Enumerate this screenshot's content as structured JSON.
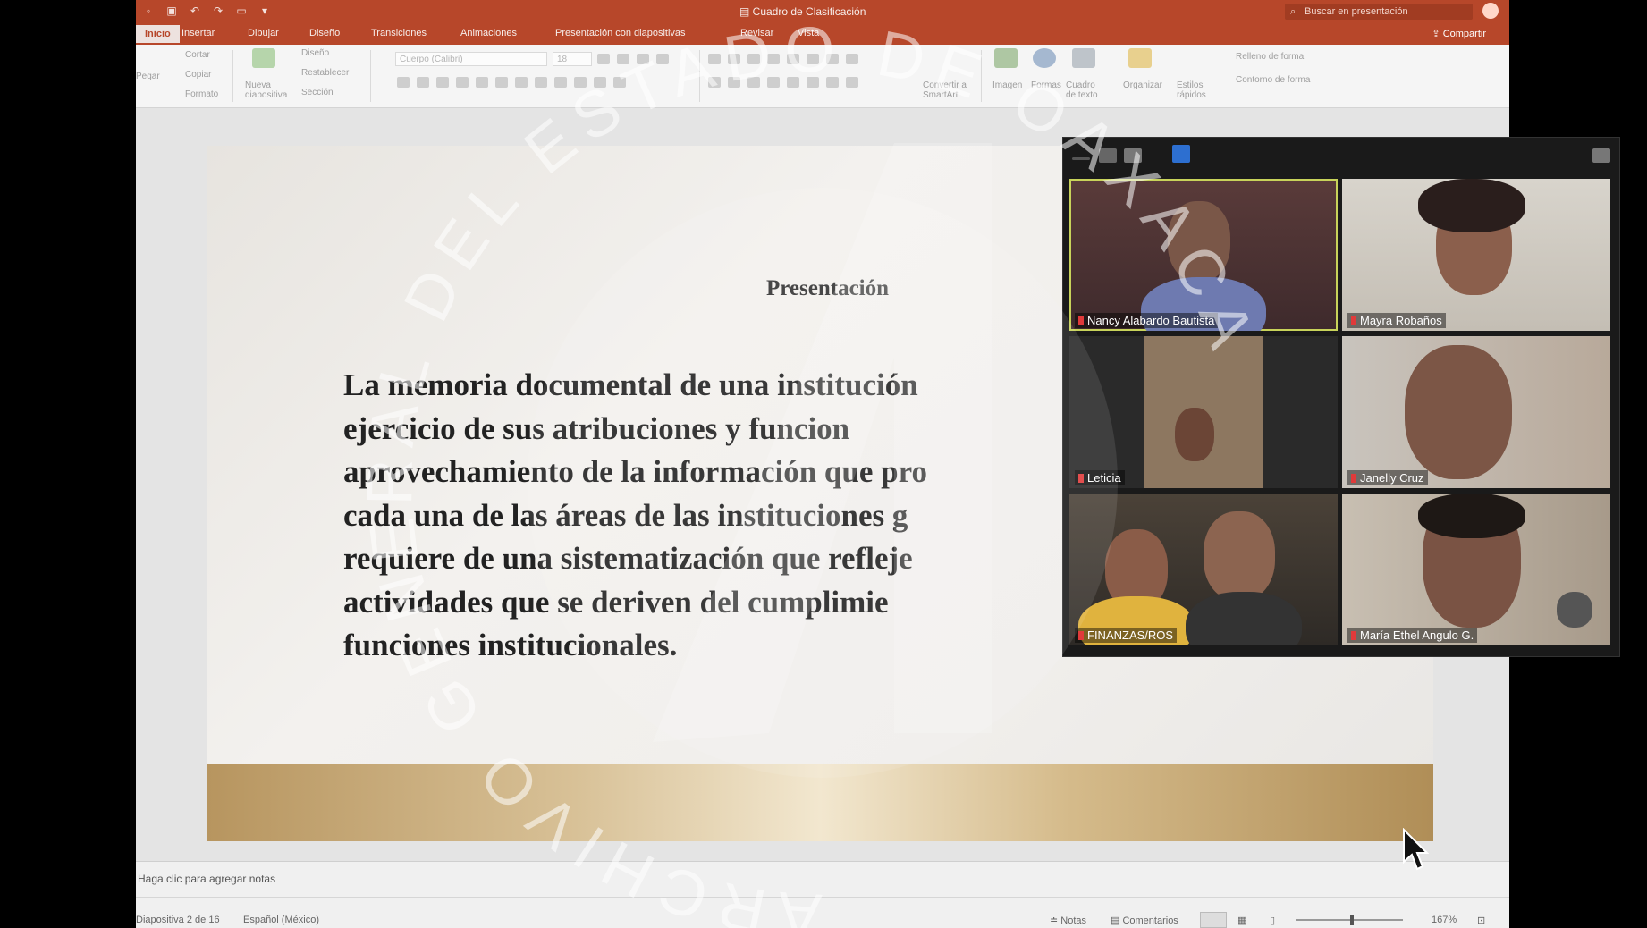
{
  "window": {
    "title": "Cuadro de Clasificación"
  },
  "quick_access": [
    "save-icon",
    "undo-icon",
    "redo-icon",
    "repeat-icon",
    "start-icon",
    "customize-icon"
  ],
  "search": {
    "placeholder": "Buscar en presentación"
  },
  "ribbon_tabs": [
    {
      "label": "Inicio"
    },
    {
      "label": "Insertar"
    },
    {
      "label": "Dibujar"
    },
    {
      "label": "Diseño"
    },
    {
      "label": "Transiciones"
    },
    {
      "label": "Animaciones"
    },
    {
      "label": "Presentación con diapositivas"
    },
    {
      "label": "Revisar"
    },
    {
      "label": "Vista"
    }
  ],
  "share_label": "Compartir",
  "ribbon": {
    "pegar": "Pegar",
    "cortar": "Cortar",
    "copiar": "Copiar",
    "formato": "Formato",
    "nueva": "Nueva diapositiva",
    "diseno": "Diseño",
    "restablecer": "Restablecer",
    "seccion": "Sección",
    "font_name": "Cuerpo (Calibri)",
    "font_size": "18",
    "convertir": "Convertir a SmartArt",
    "imagen": "Imagen",
    "formas": "Formas",
    "cuadro": "Cuadro de texto",
    "organizar": "Organizar",
    "estilos": "Estilos rápidos",
    "relleno": "Relleno de forma",
    "contorno": "Contorno de forma"
  },
  "slide": {
    "title": "Presentación",
    "body_lines": [
      "La memoria documental de una institución",
      "ejercicio de sus atribuciones y funcion",
      "aprovechamiento de la información que pro",
      "cada una de las áreas de las instituciones g",
      "requiere de una sistematización que refleje",
      "actividades que se deriven del cumplimie",
      "funciones institucionales."
    ]
  },
  "notes_placeholder": "Haga clic para agregar notas",
  "status_bar": {
    "slide_counter": "Diapositiva 2 de 16",
    "language": "Español (México)",
    "notas": "Notas",
    "comentarios": "Comentarios",
    "zoom": "167%"
  },
  "meeting": {
    "participants": [
      {
        "name": "Nancy Alabardo Bautista"
      },
      {
        "name": "Mayra Robaños"
      },
      {
        "name": "Leticia"
      },
      {
        "name": "Janelly Cruz"
      },
      {
        "name": "FINANZAS/ROS"
      },
      {
        "name": "María Ethel Angulo G."
      }
    ]
  },
  "watermark_text": "ARCHIVO GENERAL DEL ESTADO DE OAXACA",
  "colors": {
    "ribbon": "#b7472a",
    "active_speaker": "#c8d35a",
    "muted": "#e03a3a"
  }
}
